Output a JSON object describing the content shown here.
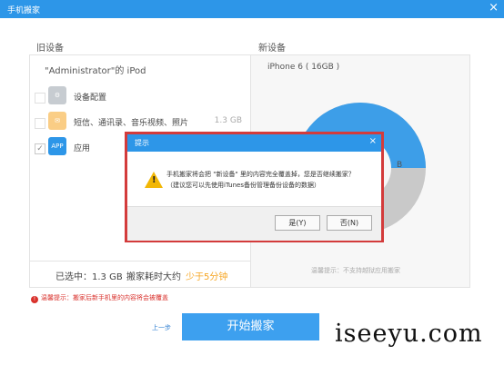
{
  "window": {
    "title": "手机搬家",
    "close_symbol": "×"
  },
  "old_device": {
    "heading": "旧设备",
    "name": "\"Administrator\"的 iPod",
    "items": [
      {
        "label": "设备配置",
        "size": "",
        "icon": "gear-icon",
        "icon_color": "#9aa4ad",
        "icon_text": "⚙",
        "checked": false
      },
      {
        "label": "短信、通讯录、音乐视频、照片",
        "size": "1.3 GB",
        "icon": "message-icon",
        "icon_color": "#f6a623",
        "icon_text": "✉",
        "checked": false
      },
      {
        "label": "应用",
        "size": "",
        "icon": "app-icon",
        "icon_color": "#2d96e8",
        "icon_text": "APP",
        "checked": true
      }
    ],
    "summary": {
      "selected": "已选中：1.3 GB",
      "time_label": "搬家耗时大约",
      "time_value": "少于5分钟"
    }
  },
  "new_device": {
    "heading": "新设备",
    "name": "iPhone 6 ( 16GB )",
    "donut_label": "B",
    "tip": "温馨提示：不支持越狱应用搬家"
  },
  "footer": {
    "warning": "温馨提示：搬家后新手机里的内容将会被覆盖",
    "prev": "上一步",
    "start": "开始搬家"
  },
  "watermark": "iseeyu.com",
  "dialog": {
    "title": "提示",
    "close_symbol": "×",
    "line1": "手机搬家将会把 \"新设备\" 里的内容完全覆盖掉，您是否继续搬家？",
    "line2": "（建议您可以先使用iTunes备份管理备份设备的数据）",
    "yes": "是(Y)",
    "no": "否(N)",
    "warning_symbol": "!"
  },
  "colors": {
    "accent": "#2d96e8",
    "highlight_border": "#d33b3b",
    "warning": "#d9312c",
    "donut_blue": "#3d9ee8",
    "donut_gray": "#c9c9c9"
  }
}
